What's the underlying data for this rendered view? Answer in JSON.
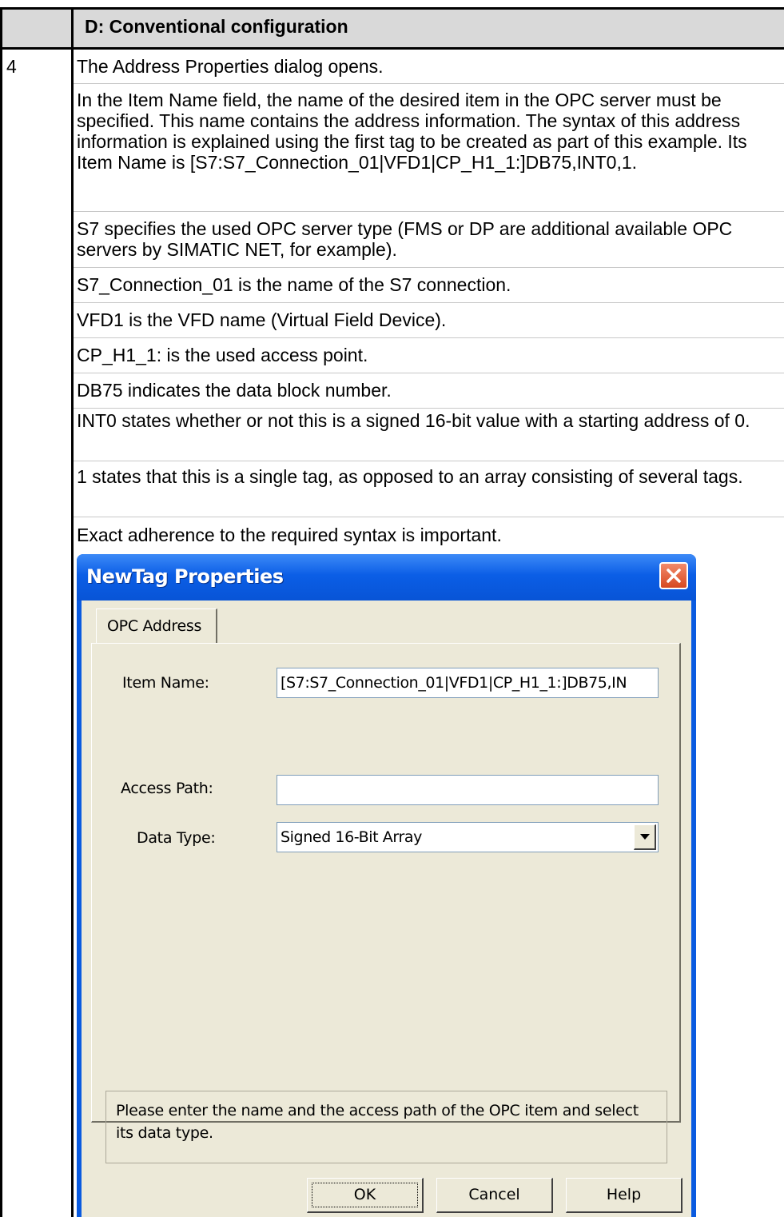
{
  "table": {
    "header": "D: Conventional configuration",
    "row_number": "4"
  },
  "paragraphs": [
    "The Address Properties dialog opens.",
    "In the Item Name field, the name of the desired item in the OPC server must be specified. This name contains the address information. The syntax of this address information is explained using the first tag to be created as part of this example. Its Item Name is [S7:S7_Connection_01|VFD1|CP_H1_1:]DB75,INT0,1.",
    "S7 specifies the used OPC server type (FMS or DP are additional available OPC servers by SIMATIC NET, for example).",
    "S7_Connection_01 is the name of the S7 connection.",
    "VFD1 is the VFD name (Virtual Field Device).",
    "CP_H1_1: is the used access point.",
    "DB75 indicates the data block number.",
    "INT0 states whether or not this is a signed 16-bit value with a starting address of 0.",
    "1 states that this is a single tag, as opposed to an array consisting of several tags.",
    "Exact adherence to the required syntax is important."
  ],
  "dialog": {
    "title": "NewTag Properties",
    "close_icon": "close-icon",
    "tab_label": "OPC Address",
    "item_name_label": "Item Name:",
    "item_name_value": "[S7:S7_Connection_01|VFD1|CP_H1_1:]DB75,IN",
    "access_path_label": "Access Path:",
    "access_path_value": "",
    "data_type_label": "Data Type:",
    "data_type_value": "Signed 16-Bit Array",
    "dropdown_icon": "chevron-down-icon",
    "hint": "Please enter the name and the access path of the OPC item and select its data type.",
    "ok_label": "OK",
    "cancel_label": "Cancel",
    "help_label": "Help"
  }
}
